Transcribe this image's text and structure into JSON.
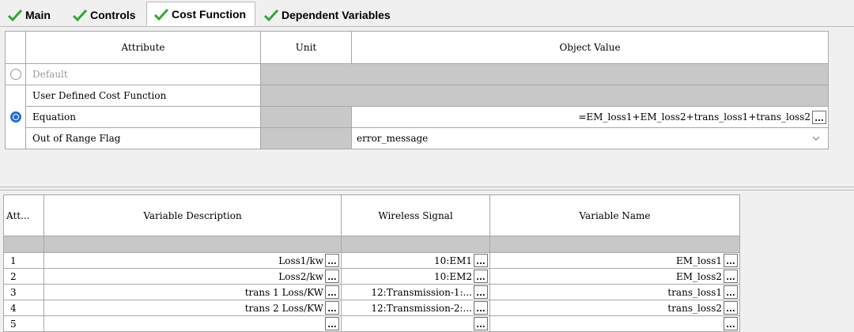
{
  "tabs": [
    {
      "label": "Main",
      "active": false
    },
    {
      "label": "Controls",
      "active": false
    },
    {
      "label": "Cost Function",
      "active": true
    },
    {
      "label": "Dependent Variables",
      "active": false
    }
  ],
  "colors": {
    "check": "#2eaa2e",
    "radio_selected": "#1f6fd6",
    "disabled_cell": "#c8c8c8"
  },
  "attributes_table": {
    "headers": {
      "attribute": "Attribute",
      "unit": "Unit",
      "object_value": "Object Value"
    },
    "rows": {
      "default": {
        "label": "Default",
        "selected": false
      },
      "user_defined": {
        "label": "User Defined Cost Function"
      },
      "equation": {
        "label": "Equation",
        "value": "=EM_loss1+EM_loss2+trans_loss1+trans_loss2",
        "selected": true
      },
      "out_of_range": {
        "label": "Out of Range Flag",
        "value": "error_message"
      }
    }
  },
  "variables_table": {
    "headers": {
      "att": "Att...",
      "description": "Variable Description",
      "signal": "Wireless Signal",
      "name": "Variable Name"
    },
    "rows": [
      {
        "num": "1",
        "description": "Loss1/kw",
        "signal": "10:EM1",
        "name": "EM_loss1"
      },
      {
        "num": "2",
        "description": "Loss2/kw",
        "signal": "10:EM2",
        "name": "EM_loss2"
      },
      {
        "num": "3",
        "description": "trans 1 Loss/KW",
        "signal": "12:Transmission-1:...",
        "name": "trans_loss1"
      },
      {
        "num": "4",
        "description": "trans 2 Loss/KW",
        "signal": "12:Transmission-2:...",
        "name": "trans_loss2"
      }
    ],
    "partial_row_num": "5"
  },
  "ellipsis": "..."
}
